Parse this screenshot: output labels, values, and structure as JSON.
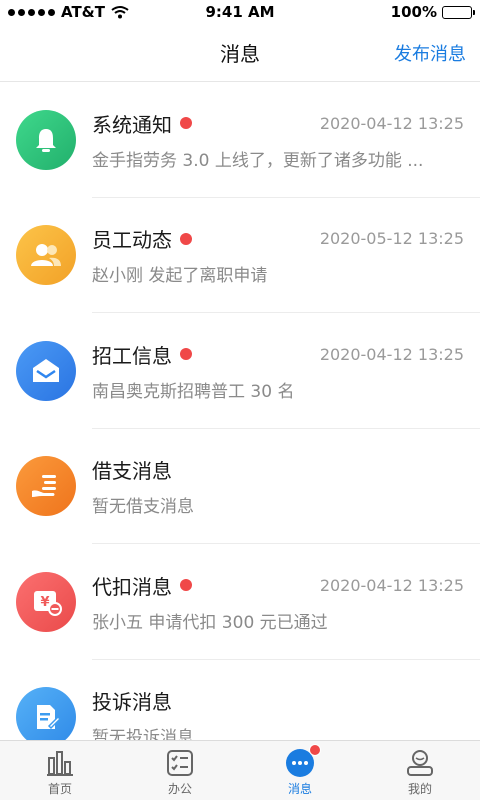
{
  "status_bar": {
    "carrier": "AT&T",
    "time": "9:41 AM",
    "battery": "100%",
    "battery_level": 1.0
  },
  "nav": {
    "title": "消息",
    "action_label": "发布消息"
  },
  "messages": [
    {
      "title": "系统通知",
      "time": "2020-04-12 13:25",
      "preview": "金手指劳务 3.0 上线了，更新了诸多功能 ...",
      "unread": true,
      "icon": "bell-icon",
      "color": "#2fc07a"
    },
    {
      "title": "员工动态",
      "time": "2020-05-12 13:25",
      "preview": "赵小刚 发起了离职申请",
      "unread": true,
      "icon": "users-icon",
      "color": "#f7b134"
    },
    {
      "title": "招工信息",
      "time": "2020-04-12 13:25",
      "preview": "南昌奥克斯招聘普工 30 名",
      "unread": true,
      "icon": "envelope-icon",
      "color": "#2f86ef"
    },
    {
      "title": "借支消息",
      "time": "",
      "preview": "暂无借支消息",
      "unread": false,
      "icon": "hand-coin-icon",
      "color": "#f5862a"
    },
    {
      "title": "代扣消息",
      "time": "2020-04-12 13:25",
      "preview": "张小五 申请代扣 300 元已通过",
      "unread": true,
      "icon": "yen-deduct-icon",
      "color": "#f05a5a"
    },
    {
      "title": "投诉消息",
      "time": "",
      "preview": "暂无投诉消息",
      "unread": false,
      "icon": "document-edit-icon",
      "color": "#3d9cf0"
    }
  ],
  "tabs": [
    {
      "label": "首页",
      "icon": "bar-chart-icon",
      "active": false
    },
    {
      "label": "办公",
      "icon": "checklist-icon",
      "active": false
    },
    {
      "label": "消息",
      "icon": "chat-dots-icon",
      "active": true,
      "badge": true
    },
    {
      "label": "我的",
      "icon": "person-icon",
      "active": false
    }
  ]
}
